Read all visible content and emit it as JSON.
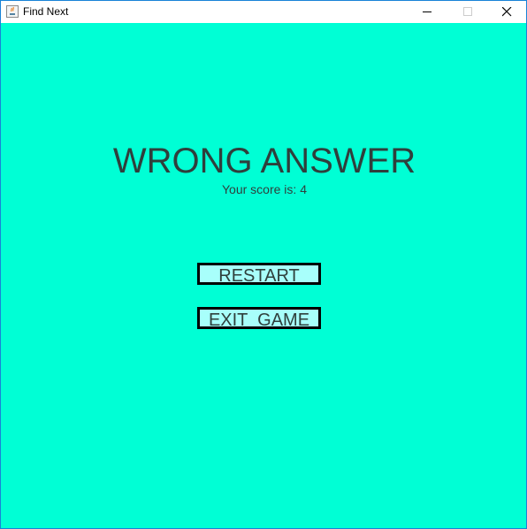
{
  "window": {
    "title": "Find Next",
    "background_color": "#00ffd5",
    "icons": {
      "app": "java-app-icon",
      "minimize": "minimize-icon",
      "maximize": "maximize-icon",
      "close": "close-icon"
    }
  },
  "result": {
    "headline": "WRONG ANSWER",
    "score_text": "Your score is: 4"
  },
  "buttons": {
    "restart_label": "RESTART",
    "exit_label": "EXIT  GAME",
    "fill_color": "#a8fffb",
    "border_color": "#000000"
  }
}
